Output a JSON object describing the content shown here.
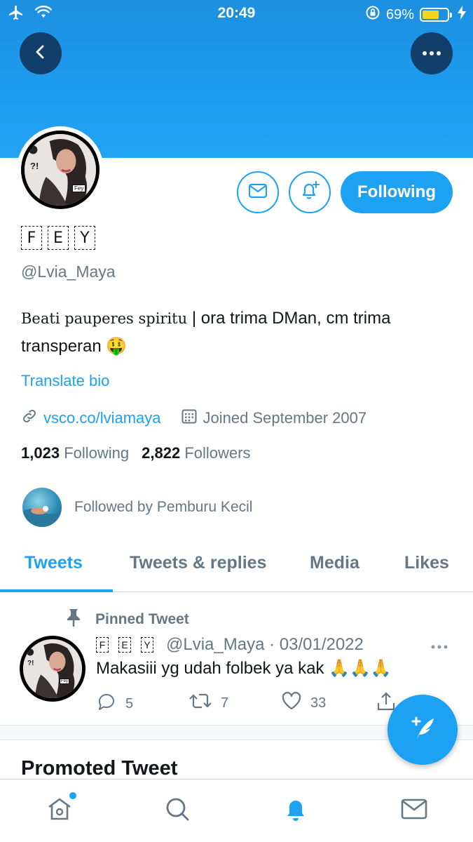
{
  "status_bar": {
    "time": "20:49",
    "battery": "69%",
    "battery_level": 0.69
  },
  "profile": {
    "display_name_letters": [
      "F",
      "E",
      "Y"
    ],
    "handle": "@Lvia_Maya",
    "bio_styled": "Beati pauperes spiritu",
    "bio_rest": " | ora trima DMan, cm trima transperan 🤑",
    "translate_label": "Translate bio",
    "website": "vsco.co/lviamaya",
    "joined": "Joined September 2007",
    "following_count": "1,023",
    "following_label": "Following",
    "followers_count": "2,822",
    "followers_label": "Followers",
    "followed_by": "Followed by Pemburu Kecil",
    "follow_button_label": "Following"
  },
  "tabs": [
    {
      "label": "Tweets",
      "active": true
    },
    {
      "label": "Tweets & replies",
      "active": false
    },
    {
      "label": "Media",
      "active": false
    },
    {
      "label": "Likes",
      "active": false
    }
  ],
  "pinned_tweet": {
    "pinned_label": "Pinned Tweet",
    "name_letters": [
      "F",
      "E",
      "Y"
    ],
    "handle_date": "@Lvia_Maya · 03/01/2022",
    "text": "Makasiii yg udah folbek ya kak 🙏🙏🙏",
    "replies": "5",
    "retweets": "7",
    "likes": "33"
  },
  "promoted_heading": "Promoted Tweet",
  "avatar_badge": "?!",
  "avatar_tag": "Fey",
  "colors": {
    "accent": "#1da1f2",
    "banner": "#1e9cf0",
    "muted": "#657786"
  },
  "icons": [
    "airplane-icon",
    "wifi-icon",
    "rotation-lock-icon",
    "battery-icon",
    "charging-icon",
    "back-arrow-icon",
    "more-icon",
    "mail-icon",
    "bell-plus-icon",
    "link-icon",
    "calendar-icon",
    "pin-icon",
    "reply-icon",
    "retweet-icon",
    "like-icon",
    "share-icon",
    "compose-icon",
    "home-icon",
    "search-icon",
    "notifications-icon",
    "messages-icon"
  ]
}
